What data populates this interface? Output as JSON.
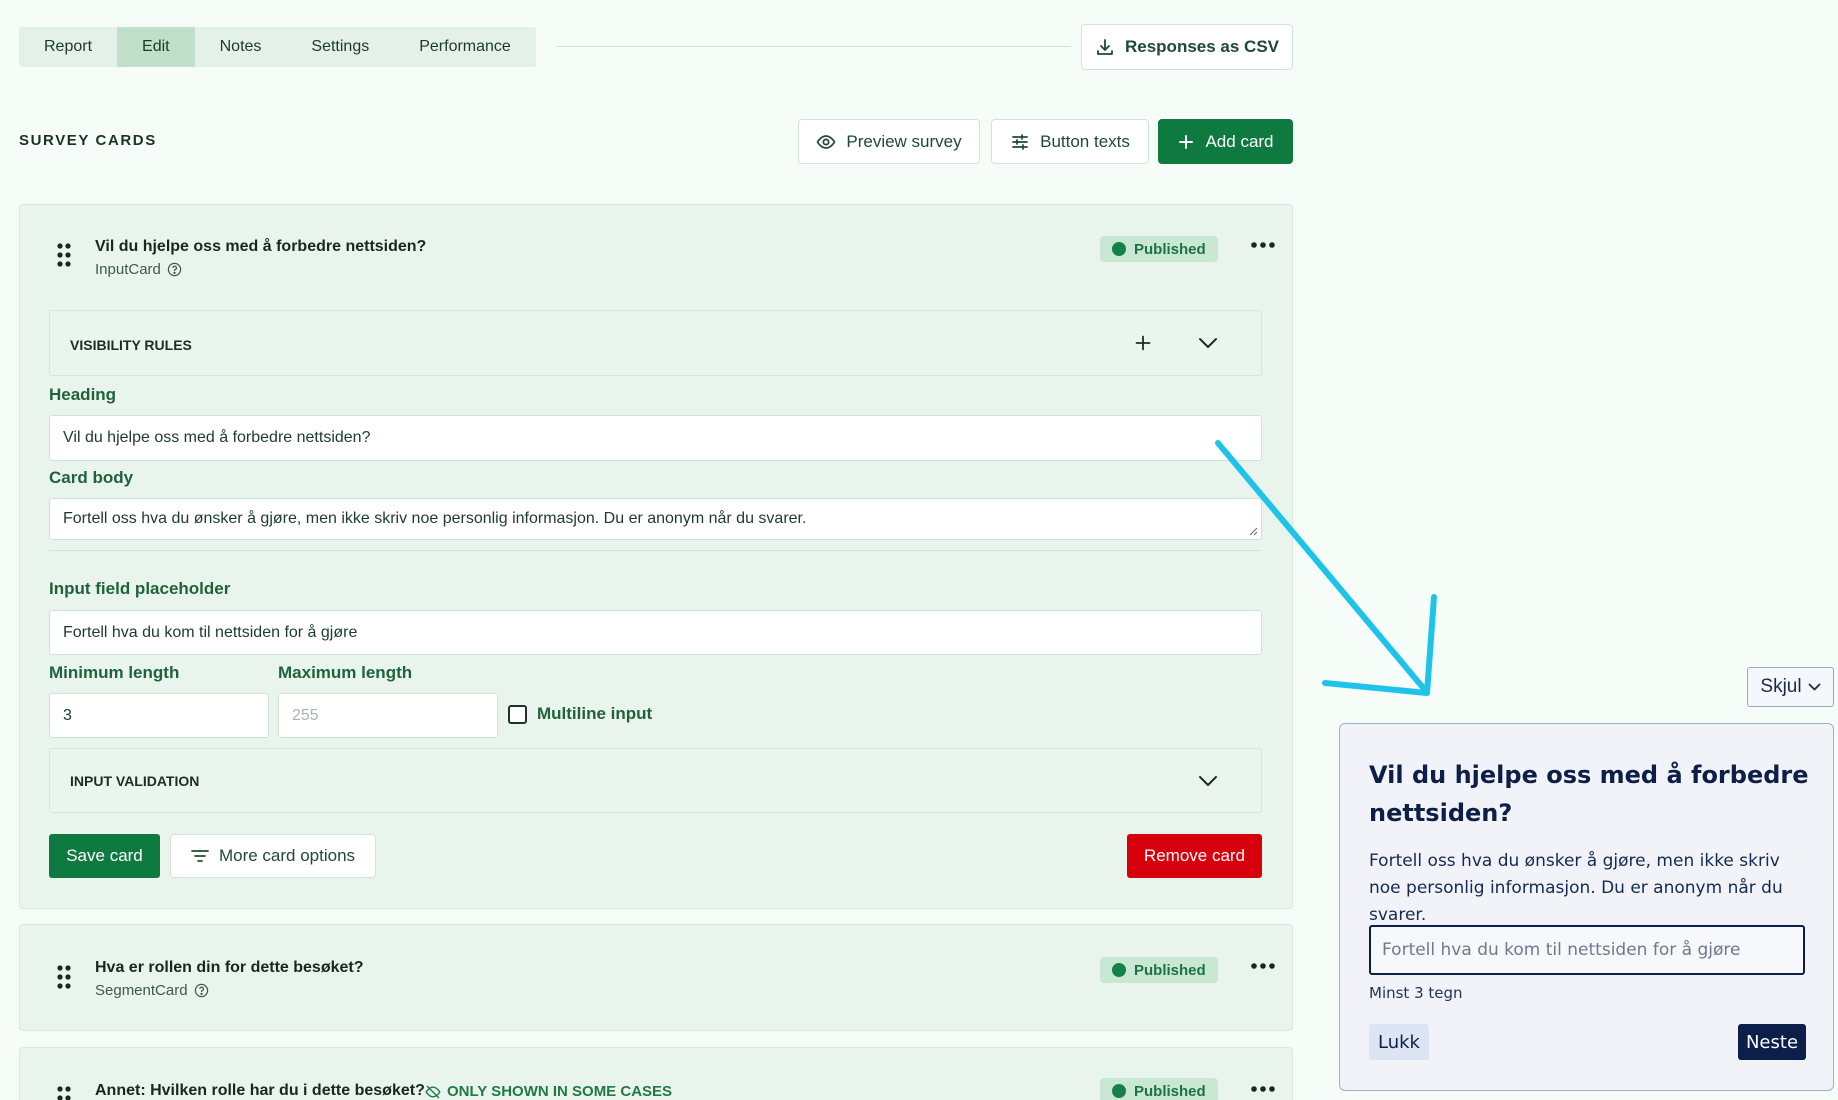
{
  "tabs": [
    {
      "label": "Report",
      "active": false
    },
    {
      "label": "Edit",
      "active": true
    },
    {
      "label": "Notes",
      "active": false
    },
    {
      "label": "Settings",
      "active": false
    },
    {
      "label": "Performance",
      "active": false
    }
  ],
  "header": {
    "csv_label": "Responses as CSV",
    "section_title": "SURVEY CARDS",
    "preview_label": "Preview survey",
    "button_texts_label": "Button texts",
    "add_card_label": "Add card"
  },
  "cards": [
    {
      "title": "Vil du hjelpe oss med å forbedre nettsiden?",
      "type": "InputCard",
      "status": "Published",
      "visibility_rules_label": "VISIBILITY RULES",
      "heading_label": "Heading",
      "heading_value": "Vil du hjelpe oss med å forbedre nettsiden?",
      "body_label": "Card body",
      "body_value": "Fortell oss hva du ønsker å gjøre, men ikke skriv noe personlig informasjon. Du er anonym når du svarer.",
      "placeholder_label": "Input field placeholder",
      "placeholder_value": "Fortell hva du kom til nettsiden for å gjøre",
      "min_label": "Minimum length",
      "min_value": "3",
      "max_label": "Maximum length",
      "max_placeholder": "255",
      "multiline_label": "Multiline input",
      "multiline_checked": false,
      "input_validation_label": "INPUT VALIDATION",
      "save_label": "Save card",
      "more_options_label": "More card options",
      "remove_label": "Remove card"
    },
    {
      "title": "Hva er rollen din for dette besøket?",
      "type": "SegmentCard",
      "status": "Published"
    },
    {
      "title": "Annet: Hvilken rolle har du i dette besøket?",
      "note": "ONLY SHOWN IN SOME CASES",
      "status": "Published"
    }
  ],
  "widget": {
    "toggle_label": "Skjul",
    "heading": "Vil du hjelpe oss med å forbedre nettsiden?",
    "body": "Fortell oss hva du ønsker å gjøre, men ikke skriv noe personlig informasjon. Du er anonym når du svarer.",
    "input_placeholder": "Fortell hva du kom til nettsiden for å gjøre",
    "hint": "Minst 3 tegn",
    "close_label": "Lukk",
    "next_label": "Neste"
  },
  "colors": {
    "primary_green": "#0e7a40",
    "danger_red": "#d8000c",
    "widget_navy": "#0b1f4a",
    "annotation_arrow": "#1ec3ea"
  }
}
